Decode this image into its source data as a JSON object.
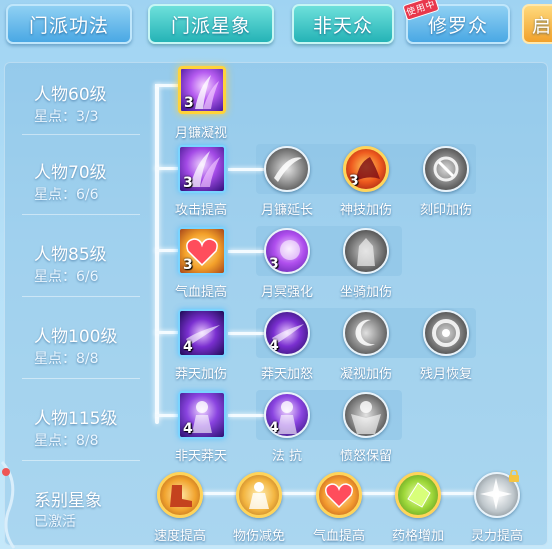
{
  "tabs": [
    {
      "label": "门派功法",
      "style": "blue",
      "active": false
    },
    {
      "label": "门派星象",
      "style": "teal",
      "active": true
    },
    {
      "label": "非天众",
      "style": "teal",
      "active": false
    },
    {
      "label": "修罗众",
      "style": "blue",
      "active": false,
      "badge": "使用中"
    },
    {
      "label": "启",
      "style": "orange",
      "active": false
    }
  ],
  "rows": [
    {
      "title": "人物60级",
      "stars": "星点：3/3",
      "main": {
        "label": "月镰凝视",
        "level": "3",
        "icon": "purple-claw-icon"
      },
      "subs": []
    },
    {
      "title": "人物70级",
      "stars": "星点：6/6",
      "main": {
        "label": "攻击提高",
        "level": "3",
        "icon": "purple-claw-icon"
      },
      "subs": [
        {
          "label": "月镰延长",
          "level": "",
          "icon": "gray-slash-icon"
        },
        {
          "label": "神技加伤",
          "level": "3",
          "icon": "flame-beast-icon"
        },
        {
          "label": "刻印加伤",
          "level": "",
          "icon": "gray-sigil-icon"
        }
      ]
    },
    {
      "title": "人物85级",
      "stars": "星点：6/6",
      "main": {
        "label": "气血提高",
        "level": "3",
        "icon": "heart-icon"
      },
      "subs": [
        {
          "label": "月冥强化",
          "level": "3",
          "icon": "purple-orb-icon"
        },
        {
          "label": "坐骑加伤",
          "level": "",
          "icon": "gray-mount-icon"
        }
      ]
    },
    {
      "title": "人物100级",
      "stars": "星点：8/8",
      "main": {
        "label": "莽天加伤",
        "level": "4",
        "icon": "purple-burst-icon"
      },
      "subs": [
        {
          "label": "莽天加怒",
          "level": "4",
          "icon": "purple-burst-icon"
        },
        {
          "label": "凝视加伤",
          "level": "",
          "icon": "gray-moon-icon"
        },
        {
          "label": "残月恢复",
          "level": "",
          "icon": "gray-ring-icon"
        }
      ]
    },
    {
      "title": "人物115级",
      "stars": "星点：8/8",
      "main": {
        "label": "非天莽天",
        "level": "4",
        "icon": "purple-figure-icon"
      },
      "subs": [
        {
          "label": "法 抗",
          "level": "4",
          "icon": "purple-figure-icon"
        },
        {
          "label": "愤怒保留",
          "level": "",
          "icon": "gray-figure-icon"
        }
      ]
    }
  ],
  "system": {
    "title": "系别星象",
    "status": "已激活",
    "items": [
      {
        "label": "速度提高",
        "icon": "speed-boot-icon",
        "locked": false
      },
      {
        "label": "物伤减免",
        "icon": "gold-figure-icon",
        "locked": false
      },
      {
        "label": "气血提高",
        "icon": "heart-icon",
        "locked": false
      },
      {
        "label": "药格增加",
        "icon": "green-gem-icon",
        "locked": false
      },
      {
        "label": "灵力提高",
        "icon": "spirit-burst-icon",
        "locked": true
      }
    ]
  },
  "colors": {
    "accent": "#ffd33a",
    "panel": "#9fd3f2",
    "teal": "#25b3b6"
  }
}
